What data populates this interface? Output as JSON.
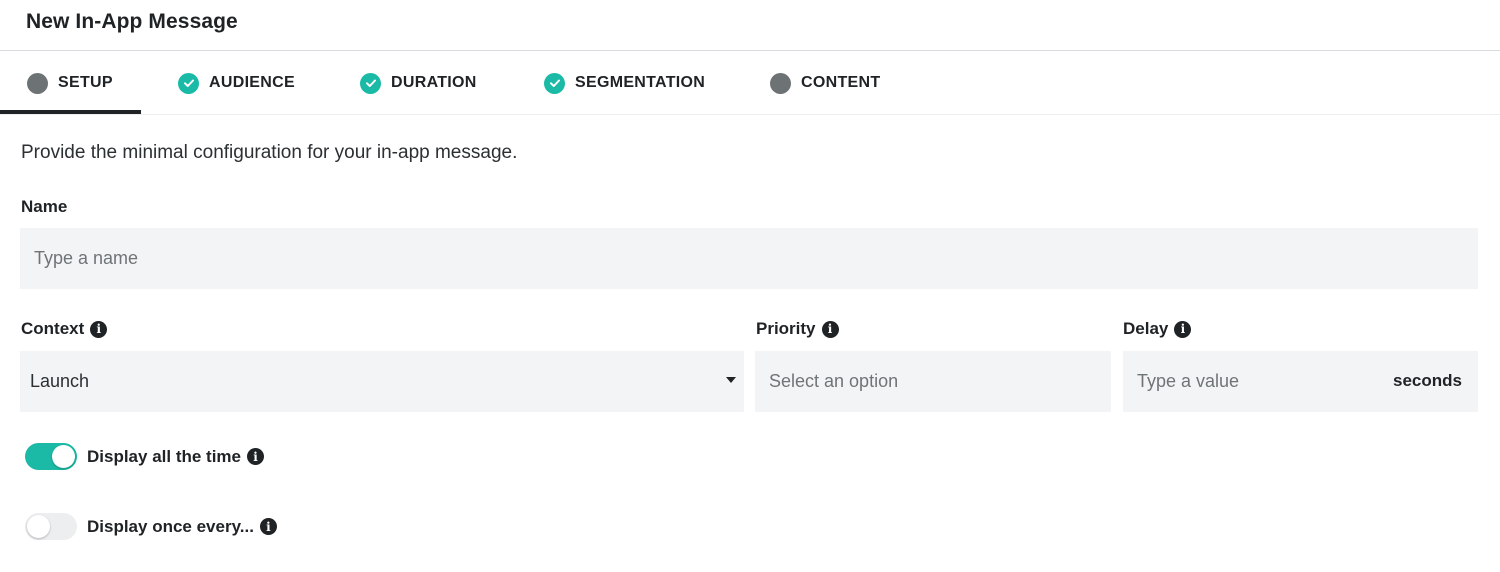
{
  "header": {
    "title": "New In-App Message"
  },
  "tabs": [
    {
      "label": "SETUP",
      "state": "active",
      "icon": "circle-icon"
    },
    {
      "label": "AUDIENCE",
      "state": "complete",
      "icon": "check-icon"
    },
    {
      "label": "DURATION",
      "state": "complete",
      "icon": "check-icon"
    },
    {
      "label": "SEGMENTATION",
      "state": "complete",
      "icon": "check-icon"
    },
    {
      "label": "CONTENT",
      "state": "incomplete",
      "icon": "circle-icon"
    }
  ],
  "form": {
    "description": "Provide the minimal configuration for your in-app message.",
    "name": {
      "label": "Name",
      "placeholder": "Type a name",
      "value": ""
    },
    "context": {
      "label": "Context",
      "value": "Launch"
    },
    "priority": {
      "label": "Priority",
      "placeholder": "Select an option"
    },
    "delay": {
      "label": "Delay",
      "placeholder": "Type a value",
      "suffix": "seconds",
      "value": ""
    },
    "toggles": [
      {
        "label": "Display all the time",
        "on": true
      },
      {
        "label": "Display once every...",
        "on": false
      }
    ]
  },
  "colors": {
    "accent": "#1bbaa6",
    "text": "#1f2326",
    "field_bg": "#f3f4f5",
    "inactive_dot": "#6d7275"
  }
}
